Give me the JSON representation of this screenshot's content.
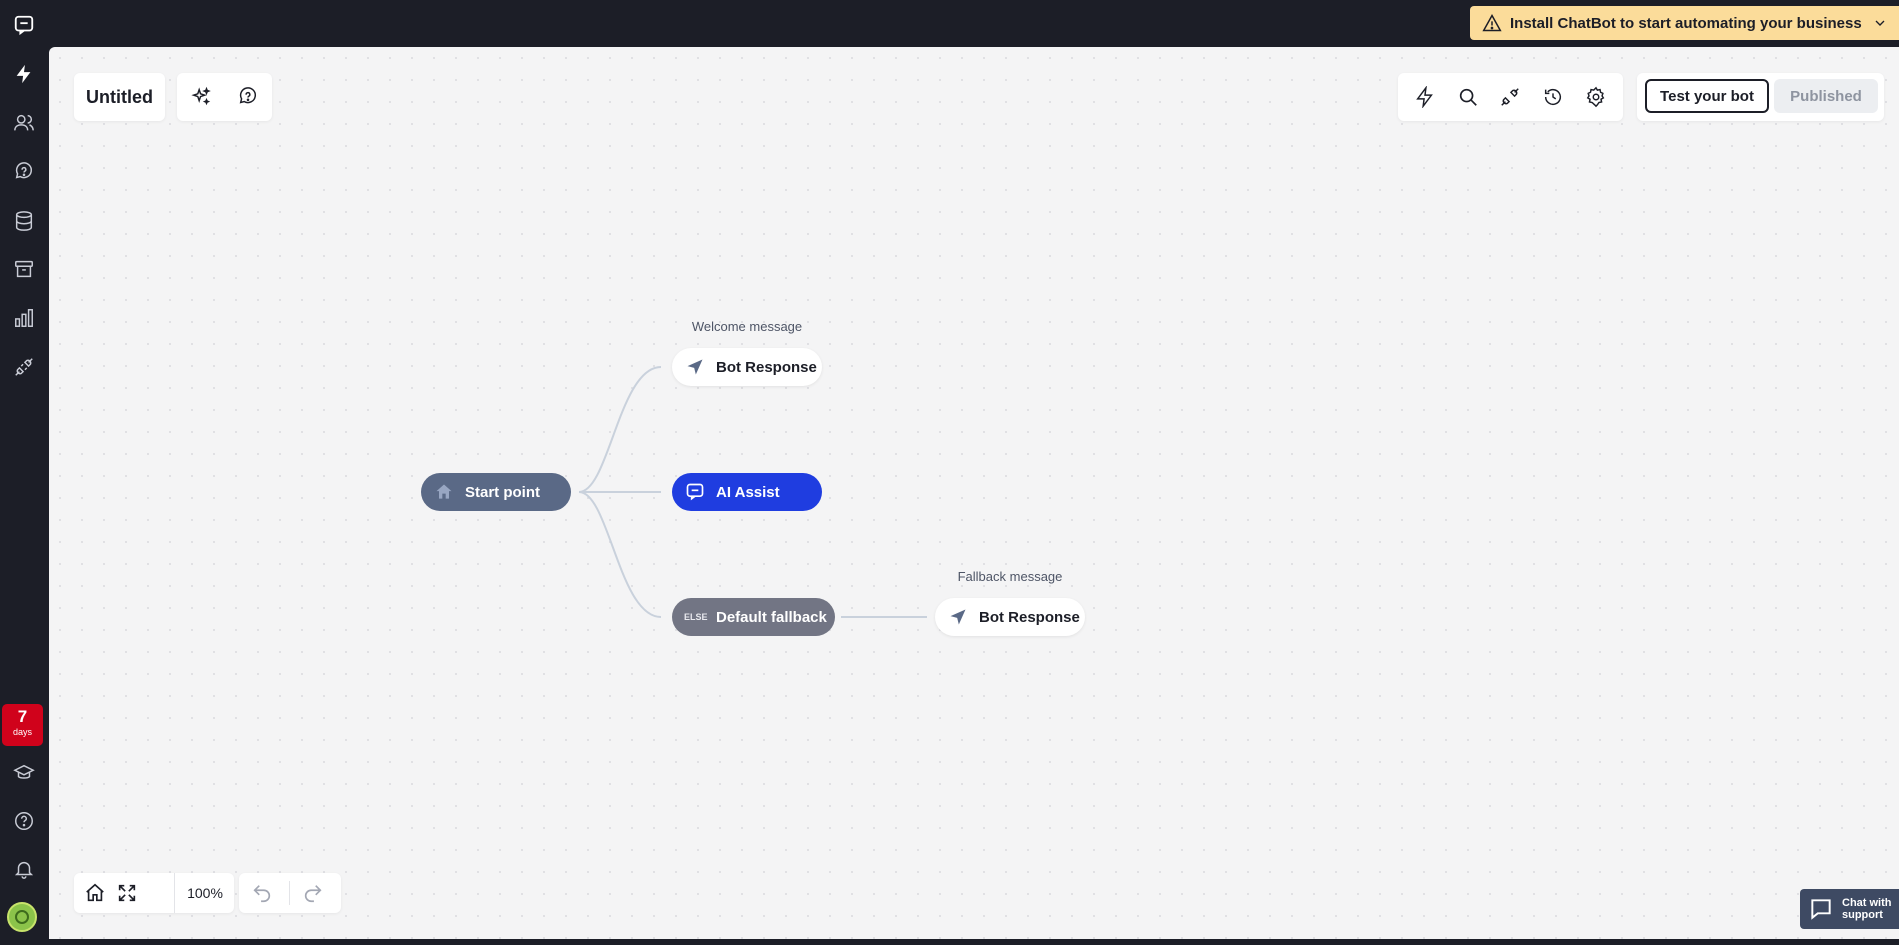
{
  "banner": {
    "text": "Install ChatBot to start automating your business"
  },
  "header": {
    "title": "Untitled"
  },
  "publish": {
    "test_label": "Test your bot",
    "published_label": "Published"
  },
  "sidebar": {
    "trial_count": "7",
    "trial_unit": "days"
  },
  "flow": {
    "start_label": "Start point",
    "welcome_caption": "Welcome message",
    "welcome_node_label": "Bot Response",
    "ai_label": "AI Assist",
    "fallback_label": "Default fallback",
    "fallback_badge": "ELSE",
    "fallback_caption": "Fallback message",
    "fallback_node_label": "Bot Response"
  },
  "controls": {
    "zoom": "100%"
  },
  "support": {
    "line1": "Chat with",
    "line2": "support"
  },
  "colors": {
    "sidebar_bg": "#1c1e27",
    "banner_bg": "#fbdc9a",
    "ai_assist": "#1f3de0",
    "start_point": "#5a6986",
    "trial_badge": "#d0021b"
  }
}
